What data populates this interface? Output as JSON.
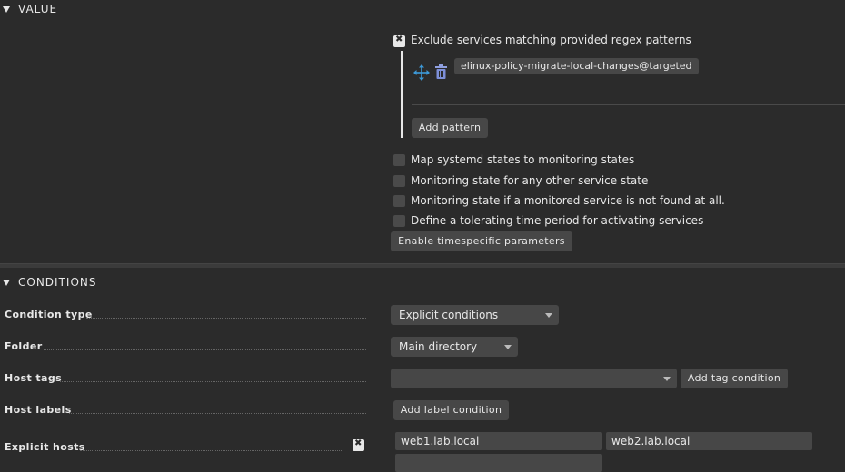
{
  "value_section": {
    "title": "VALUE",
    "exclude": {
      "label": "Exclude services matching provided regex patterns",
      "checked": true,
      "patterns": [
        "elinux-policy-migrate-local-changes@targeted"
      ],
      "add_pattern_label": "Add pattern"
    },
    "options": [
      {
        "label": "Map systemd states to monitoring states",
        "checked": false
      },
      {
        "label": "Monitoring state for any other service state",
        "checked": false
      },
      {
        "label": "Monitoring state if a monitored service is not found at all.",
        "checked": false
      },
      {
        "label": "Define a tolerating time period for activating services",
        "checked": false
      }
    ],
    "timespecific_label": "Enable timespecific parameters"
  },
  "conditions_section": {
    "title": "CONDITIONS",
    "condition_type": {
      "label": "Condition type",
      "value": "Explicit conditions"
    },
    "folder": {
      "label": "Folder",
      "value": "Main directory"
    },
    "host_tags": {
      "label": "Host tags",
      "value": "",
      "add_label": "Add tag condition"
    },
    "host_labels": {
      "label": "Host labels",
      "add_label": "Add label condition"
    },
    "explicit_hosts": {
      "label": "Explicit hosts",
      "hosts": [
        "web1.lab.local",
        "web2.lab.local",
        ""
      ]
    }
  }
}
